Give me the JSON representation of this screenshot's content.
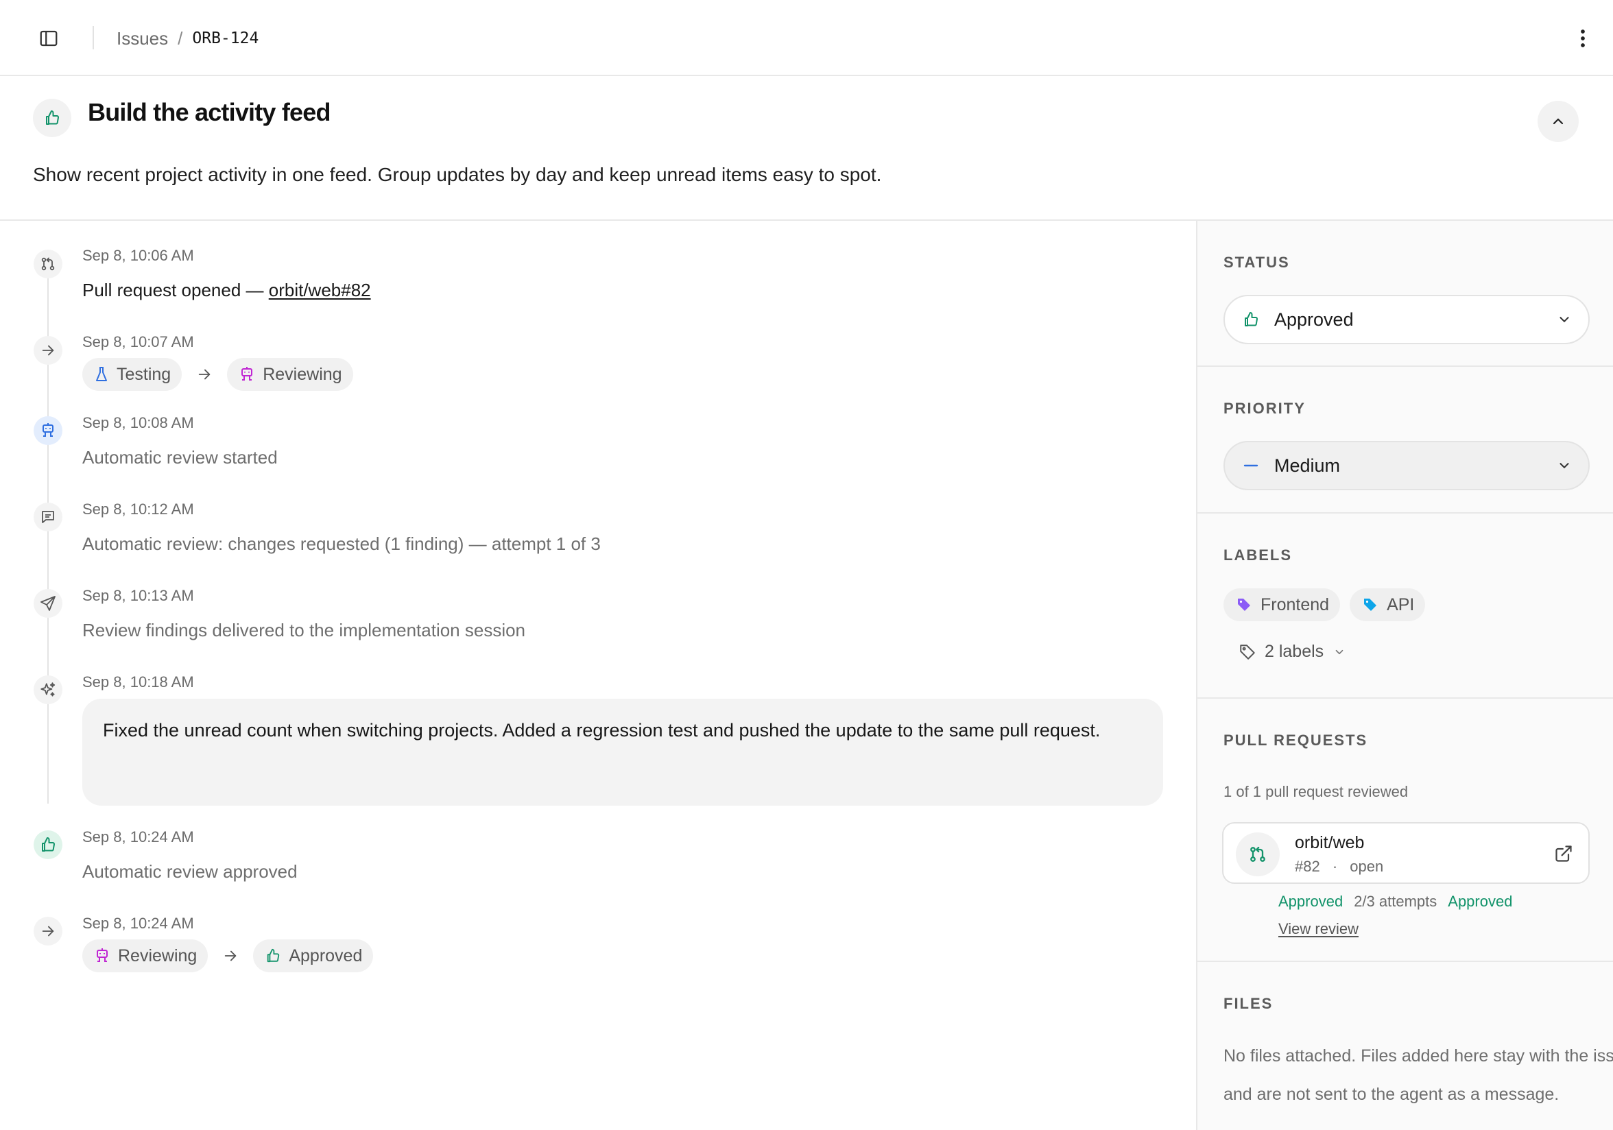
{
  "breadcrumb": {
    "parent": "Issues",
    "separator": "/",
    "current": "ORB-124"
  },
  "issue": {
    "title": "Build the activity feed",
    "description": "Show recent project activity in one feed. Group updates by day and keep unread items easy to spot."
  },
  "activity": [
    {
      "time": "Sep 8, 10:06 AM",
      "text_prefix": "Pull request opened — ",
      "link": "orbit/web#82",
      "icon": "git-pull-request-icon"
    },
    {
      "time": "Sep 8, 10:07 AM",
      "from": "Testing",
      "to": "Reviewing",
      "icon": "arrow-right-icon"
    },
    {
      "time": "Sep 8, 10:08 AM",
      "text": "Automatic review started",
      "icon": "robot-icon"
    },
    {
      "time": "Sep 8, 10:12 AM",
      "text": "Automatic review: changes requested (1 finding) — attempt 1 of 3",
      "icon": "message-icon"
    },
    {
      "time": "Sep 8, 10:13 AM",
      "text": "Review findings delivered to the implementation session",
      "icon": "send-icon"
    },
    {
      "time": "Sep 8, 10:18 AM",
      "text": "Fixed the unread count when switching projects. Added a regression test and pushed the update to the same pull request.",
      "icon": "sparkles-icon"
    },
    {
      "time": "Sep 8, 10:24 AM",
      "text": "Automatic review approved",
      "icon": "thumbs-up-icon"
    },
    {
      "time": "Sep 8, 10:24 AM",
      "from": "Reviewing",
      "to": "Approved",
      "icon": "arrow-right-icon"
    }
  ],
  "sidebar": {
    "status": {
      "title": "STATUS",
      "value": "Approved"
    },
    "priority": {
      "title": "PRIORITY",
      "value": "Medium"
    },
    "labels": {
      "title": "LABELS",
      "items": [
        "Frontend",
        "API"
      ],
      "dropdown": "2 labels"
    },
    "pull_requests": {
      "title": "PULL REQUESTS",
      "summary": "1 of 1 pull request reviewed",
      "repo": "orbit/web",
      "number": "#82",
      "meta_sep": "·",
      "state": "open",
      "review_status": "Approved",
      "attempts": "2/3 attempts",
      "final_status": "Approved",
      "view_review": "View review"
    },
    "files": {
      "title": "FILES",
      "text": "No files attached. Files added here stay with the issue and are not sent to the agent as a message."
    }
  },
  "colors": {
    "approved_green": "#12936a",
    "testing_blue": "#2f6fe0",
    "reviewing_magenta": "#c026d3",
    "frontend_label": "#8b5cf6",
    "api_label": "#0ea5e9"
  }
}
